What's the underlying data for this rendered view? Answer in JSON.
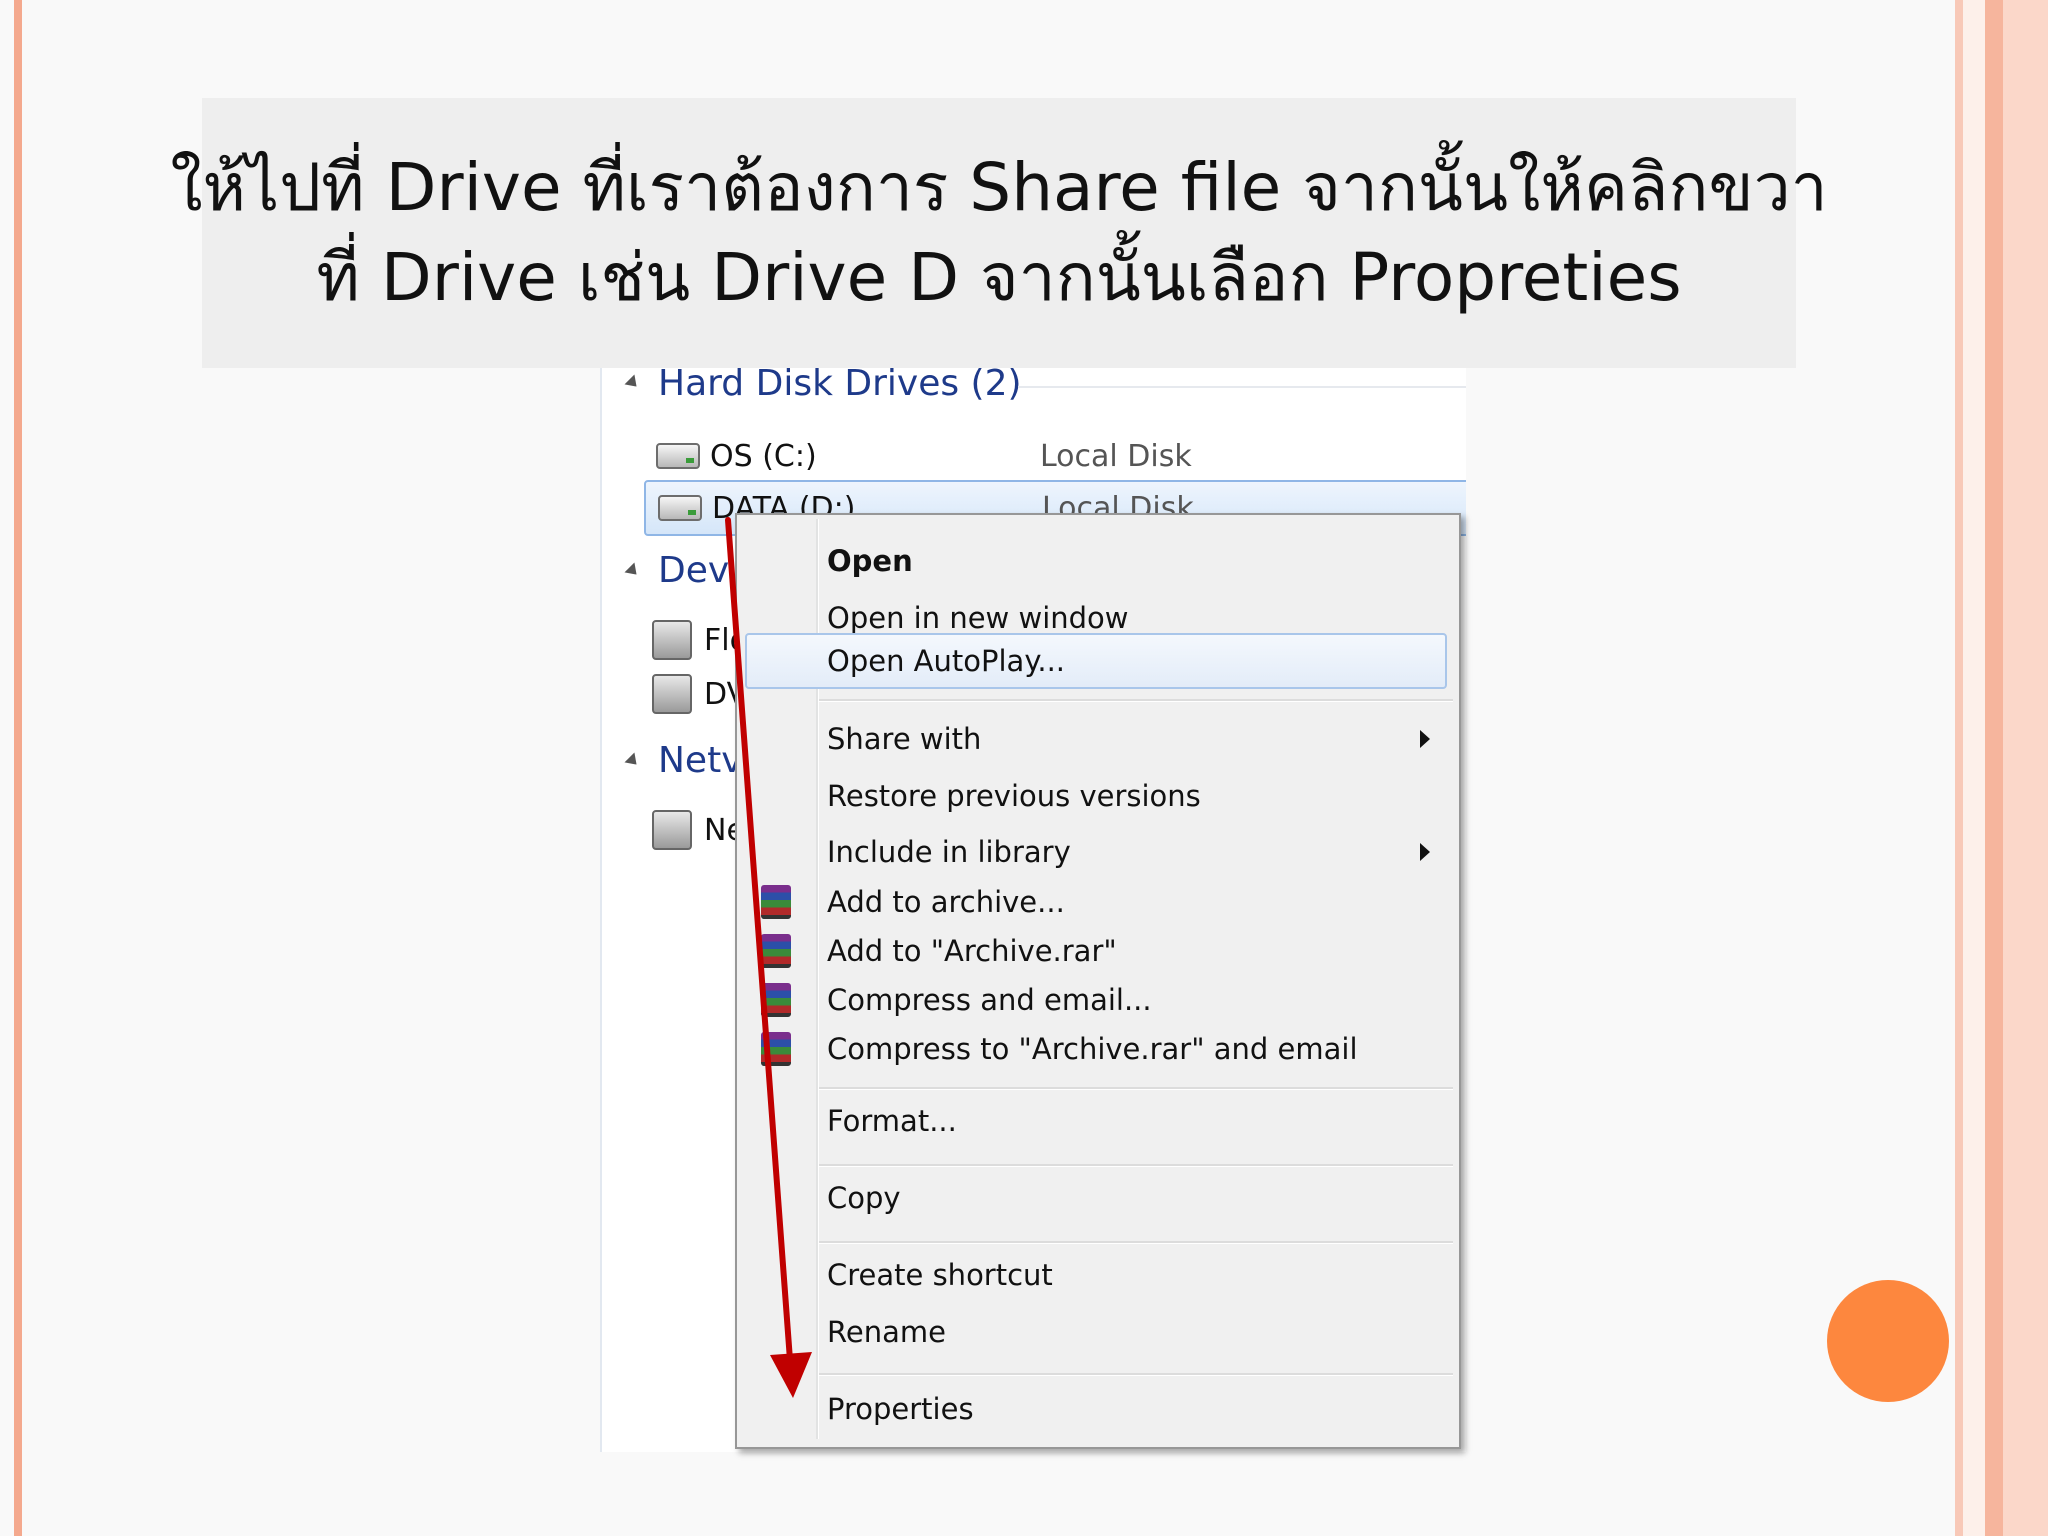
{
  "slide": {
    "title_line1": "ให้ไปที่ Drive ที่เราต้องการ Share file จากนั้นให้คลิกขวา",
    "title_line2": "ที่ Drive เช่น Drive D จากนั้นเลือก Propreties",
    "accent_color": "#fd873e",
    "border_color": "#f4a98e"
  },
  "explorer": {
    "groups": {
      "hard_disk": "Hard Disk Drives (2)",
      "devices": "Dev",
      "network": "Netv"
    },
    "drives": [
      {
        "name": "OS (C:)",
        "type": "Local Disk",
        "icon": "hard-drive-icon"
      },
      {
        "name": "DATA (D:)",
        "type": "Local Disk",
        "icon": "hard-drive-icon"
      }
    ],
    "devices": [
      {
        "name": "Flo",
        "icon": "floppy-drive-icon"
      },
      {
        "name": "DV",
        "icon": "dvd-drive-icon"
      }
    ],
    "network": [
      {
        "name": "Ne",
        "icon": "network-icon"
      }
    ]
  },
  "context_menu": {
    "open": "Open",
    "open_new_window": "Open in new window",
    "open_autoplay": "Open AutoPlay...",
    "share_with": "Share with",
    "restore": "Restore previous versions",
    "include_library": "Include in library",
    "add_archive": "Add to archive...",
    "add_archive_rar": "Add to \"Archive.rar\"",
    "compress_email": "Compress and email...",
    "compress_rar_email": "Compress to \"Archive.rar\" and email",
    "format": "Format...",
    "copy": "Copy",
    "create_shortcut": "Create shortcut",
    "rename": "Rename",
    "properties": "Properties"
  }
}
